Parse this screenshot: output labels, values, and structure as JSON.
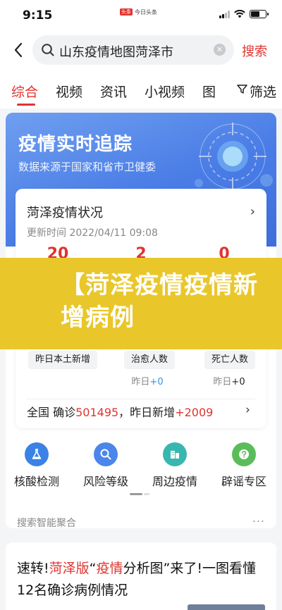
{
  "status_bar": {
    "time": "9:15",
    "app_badge": "头条",
    "app_name": "今日头条"
  },
  "search": {
    "query": "山东疫情地图菏泽市",
    "submit_label": "搜索"
  },
  "tabs": {
    "items": [
      {
        "label": "综合",
        "active": true
      },
      {
        "label": "视频"
      },
      {
        "label": "资讯"
      },
      {
        "label": "小视频"
      },
      {
        "label": "图"
      }
    ],
    "filter_label": "筛选"
  },
  "hero": {
    "title": "疫情实时追踪",
    "subtitle": "数据来源于国家和省市卫健委"
  },
  "status_card": {
    "title": "菏泽疫情状况",
    "updated": "更新时间 2022/04/11 09:08",
    "numbers": [
      "20",
      "2",
      "0"
    ],
    "labels": [
      "昨日本土新增",
      "治愈人数",
      "死亡人数"
    ],
    "deltas": [
      {
        "prefix": "",
        "value": ""
      },
      {
        "prefix": "昨日",
        "value": "+0"
      },
      {
        "prefix": "昨日",
        "value": "+0"
      }
    ],
    "colors": {
      "red": "#e0332f",
      "blue": "#3b8fe0"
    }
  },
  "national": {
    "prefix": "全国 确诊",
    "confirmed": "501495",
    "middle": "，昨日新增",
    "new_cases": "+2009"
  },
  "tools": [
    {
      "label": "核酸检测",
      "icon": "flask-icon",
      "color": "#3b82e6"
    },
    {
      "label": "风险等级",
      "icon": "search-icon",
      "color": "#4b86ea"
    },
    {
      "label": "周边疫情",
      "icon": "buildings-icon",
      "color": "#38b7b0"
    },
    {
      "label": "辟谣专区",
      "icon": "question-icon",
      "color": "#5bbd5a"
    }
  ],
  "aggregate": {
    "label": "搜索智能聚合",
    "more": "..."
  },
  "article": {
    "parts": [
      "速转!",
      "菏泽版",
      "“",
      "疫情",
      "分析图”来了!一图看懂12名确诊病例情况"
    ]
  },
  "banner": {
    "text": "【菏泽疫情疫情新增病例"
  }
}
